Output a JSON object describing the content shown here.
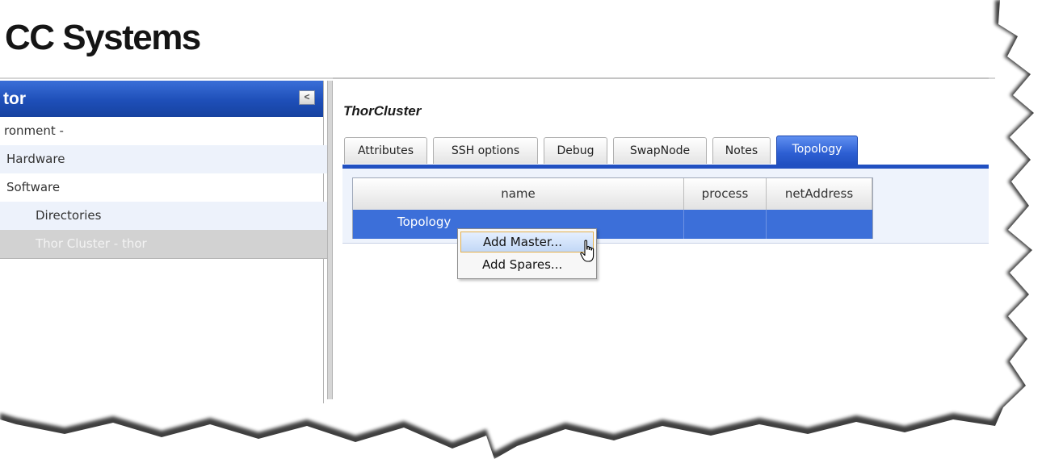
{
  "header": {
    "logo_text": "CC Systems"
  },
  "navigator": {
    "title": "tor",
    "collapse_glyph": "<",
    "items": [
      {
        "label": "ronment -"
      },
      {
        "label": "Hardware"
      },
      {
        "label": "Software"
      },
      {
        "label": "Directories"
      },
      {
        "label": "Thor Cluster - thor",
        "selected": true
      }
    ]
  },
  "content": {
    "title": "ThorCluster",
    "tabs": [
      {
        "label": "Attributes"
      },
      {
        "label": "SSH options"
      },
      {
        "label": "Debug"
      },
      {
        "label": "SwapNode"
      },
      {
        "label": "Notes"
      },
      {
        "label": "Topology",
        "active": true
      }
    ],
    "grid": {
      "columns": [
        "name",
        "process",
        "netAddress"
      ],
      "rows": [
        {
          "name": "Topology",
          "process": "",
          "netAddress": ""
        }
      ]
    },
    "context_menu": {
      "items": [
        {
          "label": "Add Master...",
          "highlighted": true
        },
        {
          "label": "Add Spares..."
        }
      ]
    }
  },
  "colors": {
    "accent": "#2150c1",
    "selected_row": "#3c6fd9",
    "menu_highlight_border": "#e3b04d"
  }
}
